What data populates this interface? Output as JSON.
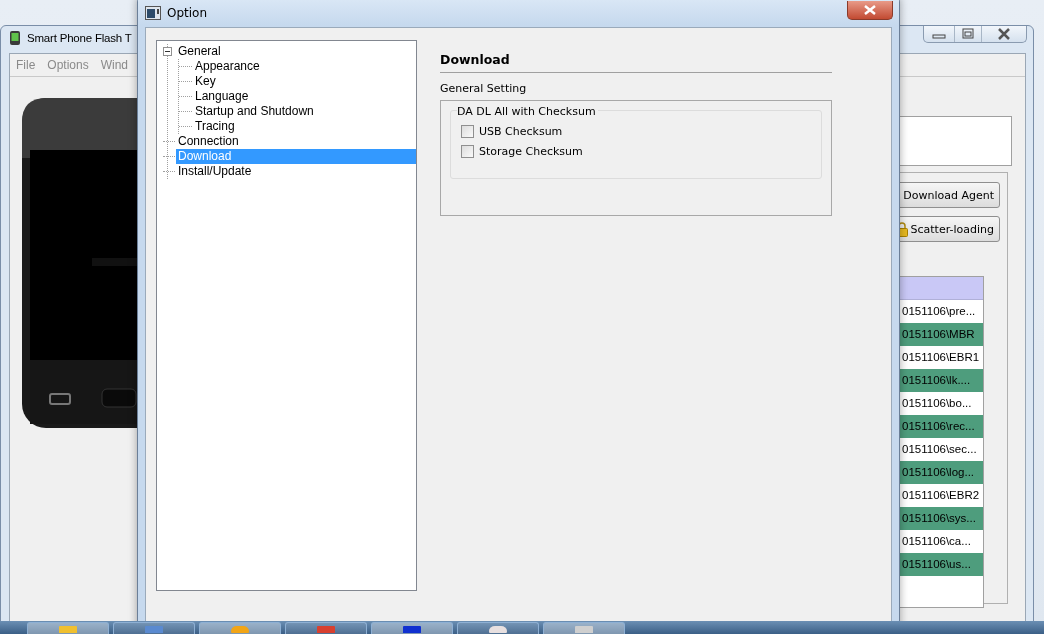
{
  "main_window": {
    "title": "Smart Phone Flash T",
    "menu": [
      "File",
      "Options",
      "Wind"
    ],
    "buttons": [
      {
        "label": "Download Agent"
      },
      {
        "label": "Scatter-loading"
      }
    ],
    "table": {
      "rows": [
        {
          "location": "0151106\\pre...",
          "highlighted": false
        },
        {
          "location": "0151106\\MBR",
          "highlighted": true
        },
        {
          "location": "0151106\\EBR1",
          "highlighted": false
        },
        {
          "location": "0151106\\lk....",
          "highlighted": true
        },
        {
          "location": "0151106\\bo...",
          "highlighted": false
        },
        {
          "location": "0151106\\rec...",
          "highlighted": true
        },
        {
          "location": "0151106\\sec...",
          "highlighted": false
        },
        {
          "location": "0151106\\log...",
          "highlighted": true
        },
        {
          "location": "0151106\\EBR2",
          "highlighted": false
        },
        {
          "location": "0151106\\sys...",
          "highlighted": true
        },
        {
          "location": "0151106\\ca...",
          "highlighted": false
        },
        {
          "location": "0151106\\us...",
          "highlighted": true
        }
      ]
    }
  },
  "dialog": {
    "title": "Option",
    "tree": [
      {
        "label": "General",
        "expanded": true,
        "selected": false,
        "children": [
          {
            "label": "Appearance",
            "selected": false
          },
          {
            "label": "Key",
            "selected": false
          },
          {
            "label": "Language",
            "selected": false
          },
          {
            "label": "Startup and Shutdown",
            "selected": false
          },
          {
            "label": "Tracing",
            "selected": false
          }
        ]
      },
      {
        "label": "Connection",
        "selected": false
      },
      {
        "label": "Download",
        "selected": true
      },
      {
        "label": "Install/Update",
        "selected": false
      }
    ],
    "page": {
      "heading": "Download",
      "section": "General Setting",
      "group": {
        "title": "DA DL All with Checksum",
        "options": [
          {
            "label": "USB Checksum",
            "checked": false
          },
          {
            "label": "Storage Checksum",
            "checked": false
          }
        ]
      }
    }
  }
}
